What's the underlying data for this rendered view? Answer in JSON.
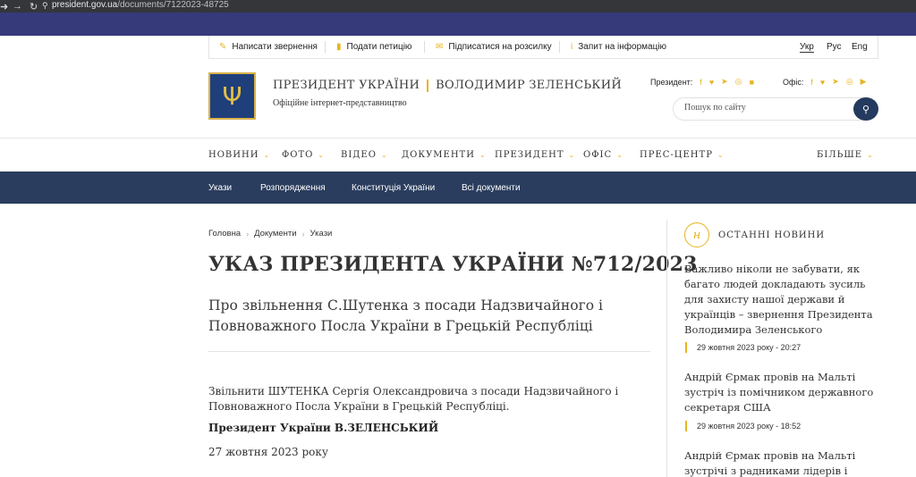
{
  "browser": {
    "url_host": "president.gov.ua",
    "url_path": "/documents/7122023-48725"
  },
  "utility": {
    "items": [
      {
        "label": "Написати звернення",
        "icon": "pen-icon"
      },
      {
        "label": "Подати петицію",
        "icon": "document-icon"
      },
      {
        "label": "Підписатися на розсилку",
        "icon": "mail-icon"
      },
      {
        "label": "Запит на інформацію",
        "icon": "info-icon"
      }
    ],
    "languages": [
      "Укр",
      "Рус",
      "Eng"
    ],
    "active_language": "Укр"
  },
  "header": {
    "title_left": "ПРЕЗИДЕНТ УКРАЇНИ",
    "title_right": "ВОЛОДИМИР ЗЕЛЕНСЬКИЙ",
    "subtitle": "Офіційне інтернет-представництво",
    "president_label": "Президент:",
    "office_label": "Офіс:",
    "search_placeholder": "Пошук по сайту"
  },
  "main_nav": [
    "НОВИНИ",
    "ФОТО",
    "ВІДЕО",
    "ДОКУМЕНТИ",
    "ПРЕЗИДЕНТ",
    "ОФІС",
    "ПРЕС-ЦЕНТР",
    "БІЛЬШЕ"
  ],
  "sub_nav": [
    "Укази",
    "Розпорядження",
    "Конституція України",
    "Всі документи"
  ],
  "breadcrumb": [
    "Головна",
    "Документи",
    "Укази"
  ],
  "document": {
    "title": "УКАЗ ПРЕЗИДЕНТА УКРАЇНИ №712/2023",
    "subtitle": "Про звільнення С.Шутенка з посади Надзвичайного і Повноважного Посла України в Грецькій Республіці",
    "body": "Звільнити ШУТЕНКА Сергія Олександровича з посади Надзвичайного і Повноважного Посла України в Грецькій Республіці.",
    "signature": "Президент України В.ЗЕЛЕНСЬКИЙ",
    "date": "27 жовтня 2023 року"
  },
  "sidebar": {
    "heading": "ОСТАННІ НОВИНИ",
    "heading_icon_letter": "н",
    "news": [
      {
        "title": "Важливо ніколи не забувати, як багато людей докладають зусиль для захисту нашої держави й українців – звернення Президента Володимира Зеленського",
        "date": "29 жовтня 2023 року - 20:27"
      },
      {
        "title": "Андрій Єрмак провів на Мальті зустріч із помічником державного секретаря США",
        "date": "29 жовтня 2023 року - 18:52"
      },
      {
        "title": "Андрій Єрмак провів на Мальті зустрічі з радниками лідерів і",
        "date": ""
      }
    ]
  },
  "colors": {
    "accent": "#e6b51f",
    "navy": "#2a3d5e",
    "browser_strip": "#363a7a"
  }
}
